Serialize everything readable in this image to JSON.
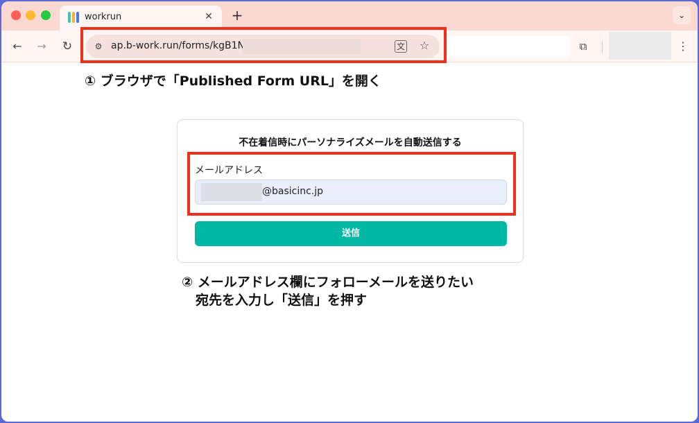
{
  "browser": {
    "tab": {
      "title": "workrun",
      "favicon_colors": [
        "#3ec7b0",
        "#f2b233",
        "#4a78e8"
      ]
    },
    "url": "ap.b-work.run/forms/kgB1Np("
  },
  "instructions": {
    "step1": "① ブラウザで「Published Form URL」を開く",
    "step2_line1": "② メールアドレス欄にフォローメールを送りたい",
    "step2_line2": "宛先を入力し「送信」を押す"
  },
  "form": {
    "title": "不在着信時にパーソナライズメールを自動送信する",
    "email_label": "メールアドレス",
    "email_value": "@basicinc.jp",
    "submit_label": "送信"
  },
  "colors": {
    "accent": "#00b8a4",
    "highlight": "#f0301a"
  }
}
